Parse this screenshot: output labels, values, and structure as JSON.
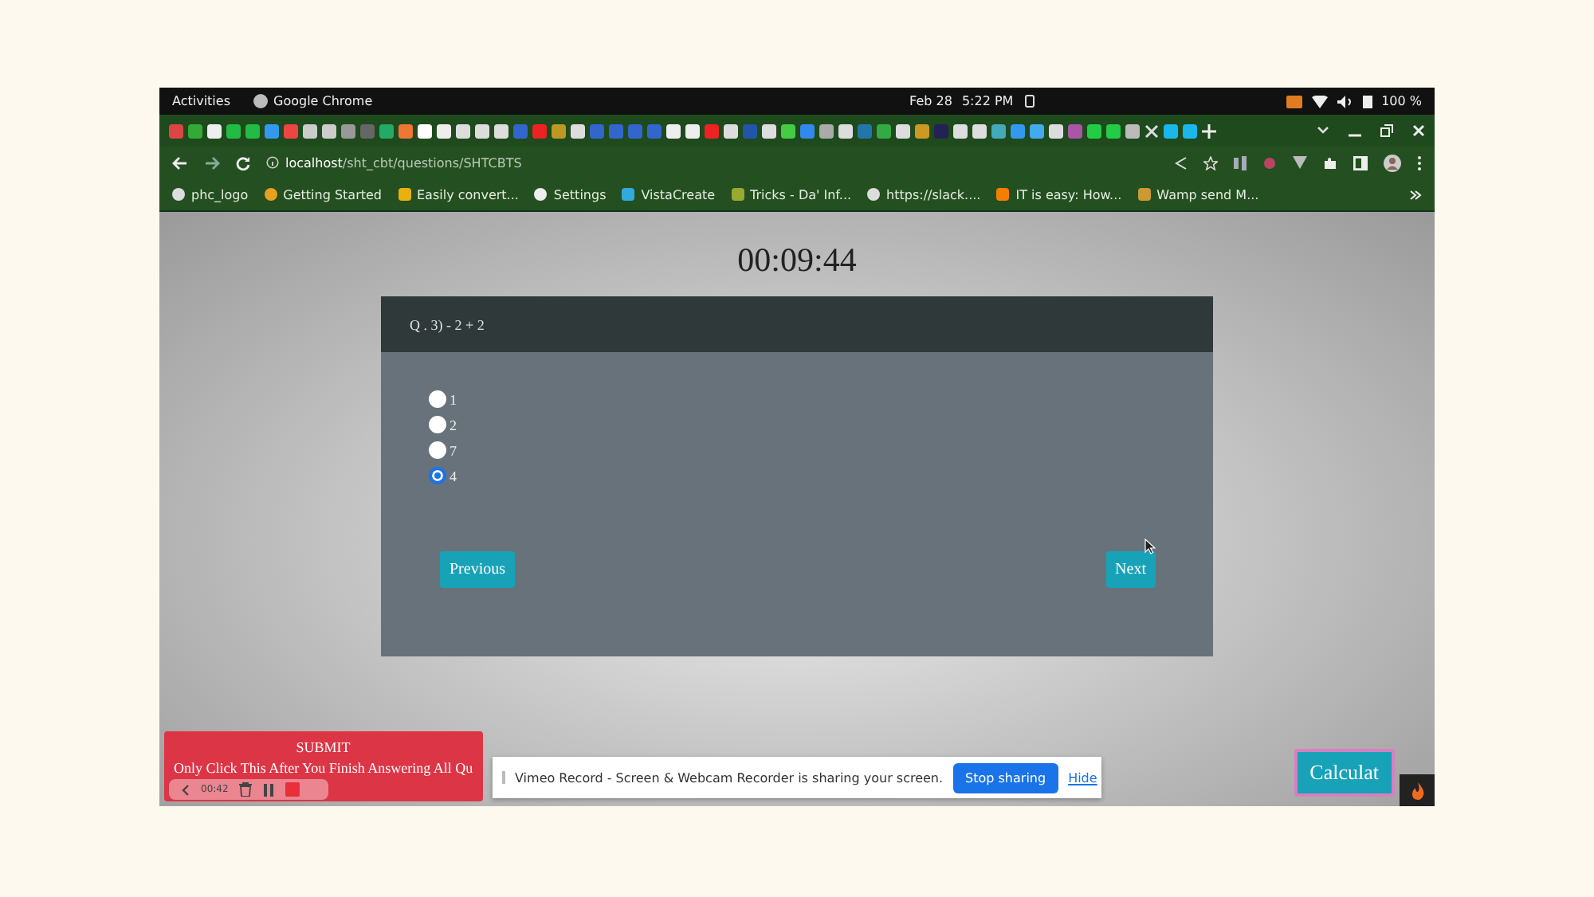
{
  "system_bar": {
    "activities": "Activities",
    "app": "Google Chrome",
    "date": "Feb 28",
    "time": "5:22 PM",
    "battery": "100 %"
  },
  "address_bar": {
    "host": "localhost",
    "path": "/sht_cbt/questions/SHTCBTS"
  },
  "bookmarks": [
    {
      "label": "phc_logo"
    },
    {
      "label": "Getting Started"
    },
    {
      "label": "Easily convert..."
    },
    {
      "label": "Settings"
    },
    {
      "label": "VistaCreate"
    },
    {
      "label": "Tricks - Da' Inf..."
    },
    {
      "label": "https://slack...."
    },
    {
      "label": "IT is easy: How..."
    },
    {
      "label": "Wamp send M..."
    }
  ],
  "quiz": {
    "timer": "00:09:44",
    "question": "Q . 3) - 2 + 2",
    "options": [
      {
        "label": "1",
        "selected": false
      },
      {
        "label": "2",
        "selected": false
      },
      {
        "label": "7",
        "selected": false
      },
      {
        "label": "4",
        "selected": true
      }
    ],
    "previous": "Previous",
    "next": "Next",
    "submit": {
      "title": "SUBMIT",
      "note": "Only Click This After You Finish Answering All Qu"
    },
    "calculator": "Calculat"
  },
  "recorder": {
    "timer": "00:42"
  },
  "sharing_bar": {
    "message": "Vimeo Record - Screen & Webcam Recorder is sharing your screen.",
    "stop": "Stop sharing",
    "hide": "Hide"
  }
}
